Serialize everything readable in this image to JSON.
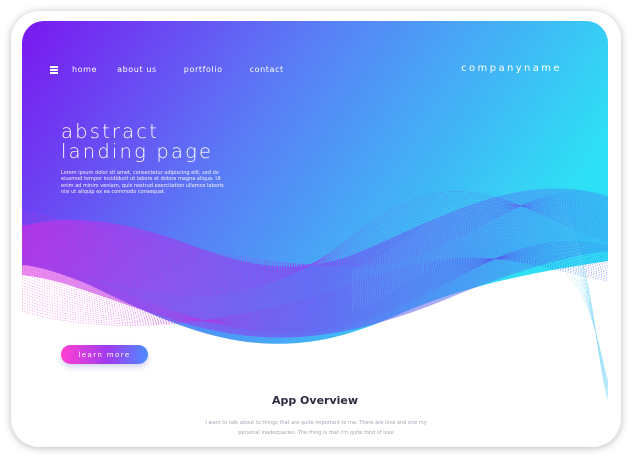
{
  "nav": {
    "menu_icon": "hamburger-menu-icon",
    "items": [
      {
        "label": "home"
      },
      {
        "label": "about us"
      },
      {
        "label": "portfolio"
      },
      {
        "label": "contact"
      }
    ]
  },
  "company_name": "companyname",
  "hero": {
    "title_line1": "abstract",
    "title_line2": "landing page",
    "body": "Lorem ipsum dolor sit amet, consectetur adipiscing elit, sed do eiusmod tempor incididunt ut labore et dolore magna aliqua. Ut enim ad minim veniam, quis nostrud exercitation ullamco laboris nisi ut aliquip ex ea commodo consequat.",
    "button_label": "learn more"
  },
  "overview": {
    "title": "App Overview",
    "body": "I want to talk about to things that are quite important to me. There are love and one my personal inadequacies. The thing is that I'm quite fond of love"
  },
  "colors": {
    "gradient_purple": "#7a17f0",
    "gradient_cyan": "#2fd9f4",
    "wave_magenta": "#ff2fd0",
    "wave_blue": "#3f6cf0",
    "button_start": "#ff3fd1",
    "button_end": "#4d8cff"
  }
}
